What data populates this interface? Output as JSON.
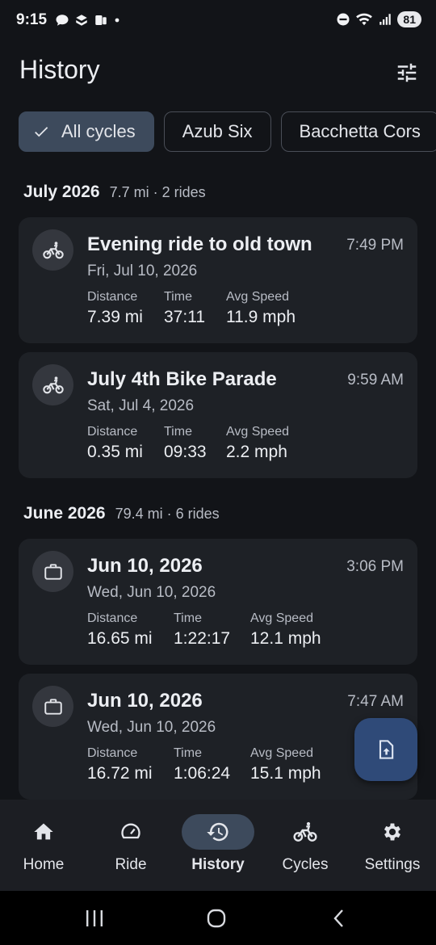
{
  "status_bar": {
    "time": "9:15",
    "battery": "81",
    "icons": [
      "chat-bubble-icon",
      "app-icon",
      "app-icon",
      "dot-icon",
      "do-not-disturb-icon",
      "wifi-icon",
      "signal-icon",
      "battery-icon"
    ]
  },
  "header": {
    "title": "History",
    "filter_icon": "tune-icon"
  },
  "chips": [
    {
      "label": "All cycles",
      "selected": true
    },
    {
      "label": "Azub Six",
      "selected": false
    },
    {
      "label": "Bacchetta Cors",
      "selected": false
    }
  ],
  "sections": [
    {
      "month": "July 2026",
      "summary": "7.7 mi · 2 rides",
      "rides": [
        {
          "icon": "bicycle-icon",
          "title": "Evening ride to old town",
          "time": "7:49 PM",
          "date": "Fri, Jul 10, 2026",
          "distance_label": "Distance",
          "distance": "7.39 mi",
          "duration_label": "Time",
          "duration": "37:11",
          "speed_label": "Avg Speed",
          "speed": "11.9 mph"
        },
        {
          "icon": "bicycle-icon",
          "title": "July 4th Bike Parade",
          "time": "9:59 AM",
          "date": "Sat, Jul 4, 2026",
          "distance_label": "Distance",
          "distance": "0.35 mi",
          "duration_label": "Time",
          "duration": "09:33",
          "speed_label": "Avg Speed",
          "speed": "2.2 mph"
        }
      ]
    },
    {
      "month": "June 2026",
      "summary": "79.4 mi · 6 rides",
      "rides": [
        {
          "icon": "briefcase-icon",
          "title": "Jun 10, 2026",
          "time": "3:06 PM",
          "date": "Wed, Jun 10, 2026",
          "distance_label": "Distance",
          "distance": "16.65 mi",
          "duration_label": "Time",
          "duration": "1:22:17",
          "speed_label": "Avg Speed",
          "speed": "12.1 mph"
        },
        {
          "icon": "briefcase-icon",
          "title": "Jun 10, 2026",
          "time": "7:47 AM",
          "date": "Wed, Jun 10, 2026",
          "distance_label": "Distance",
          "distance": "16.72 mi",
          "duration_label": "Time",
          "duration": "1:06:24",
          "speed_label": "Avg Speed",
          "speed": "15.1 mph"
        }
      ]
    }
  ],
  "fab": {
    "icon": "file-upload-icon"
  },
  "bottom_nav": [
    {
      "label": "Home",
      "icon": "home-icon",
      "active": false
    },
    {
      "label": "Ride",
      "icon": "speedometer-icon",
      "active": false
    },
    {
      "label": "History",
      "icon": "history-icon",
      "active": true
    },
    {
      "label": "Cycles",
      "icon": "bicycle-icon",
      "active": false
    },
    {
      "label": "Settings",
      "icon": "gear-icon",
      "active": false
    }
  ],
  "system_nav": [
    "recents-icon",
    "home-circle-icon",
    "back-icon"
  ],
  "colors": {
    "background": "#121418",
    "card": "#1e2126",
    "accent_container": "#3d4a5c",
    "fab": "#2f4a78"
  }
}
